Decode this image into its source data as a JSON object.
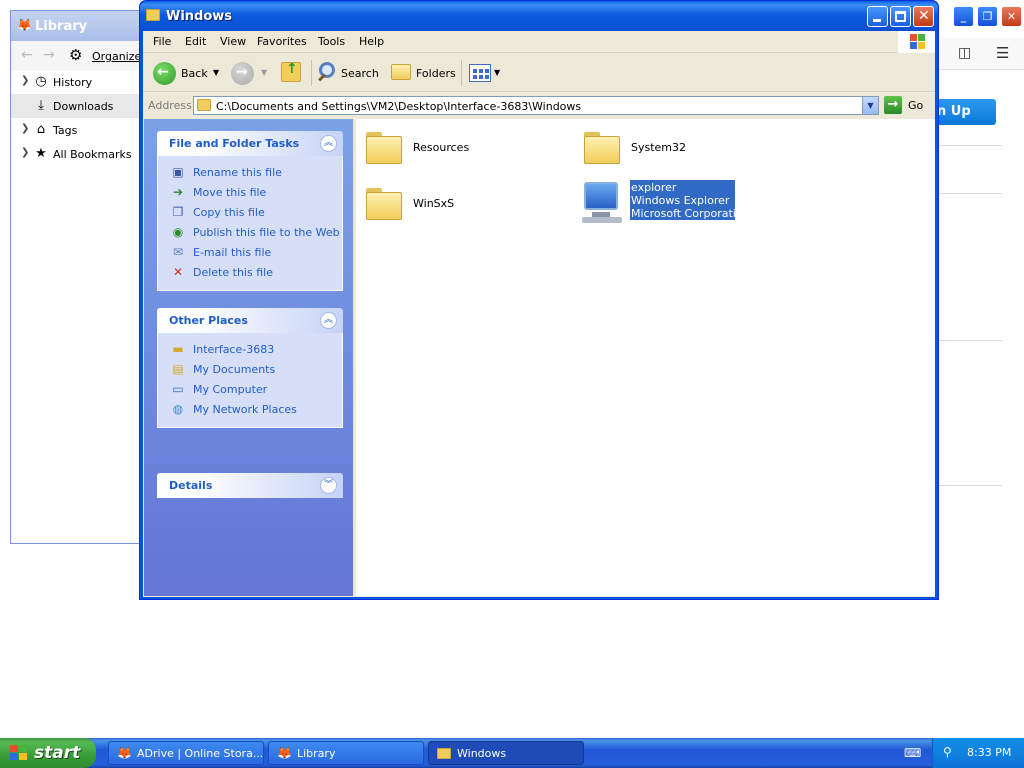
{
  "background_browser": {
    "signup_label": "n Up"
  },
  "library": {
    "title": "Library",
    "organize_label": "Organize",
    "items": [
      {
        "label": "History",
        "icon": "clock-icon",
        "expandable": true
      },
      {
        "label": "Downloads",
        "icon": "download-icon",
        "expandable": false,
        "selected": true
      },
      {
        "label": "Tags",
        "icon": "tag-icon",
        "expandable": true
      },
      {
        "label": "All Bookmarks",
        "icon": "star-icon",
        "expandable": true
      }
    ]
  },
  "explorer": {
    "title": "Windows",
    "menu": [
      "File",
      "Edit",
      "View",
      "Favorites",
      "Tools",
      "Help"
    ],
    "toolbar": {
      "back": "Back",
      "search": "Search",
      "folders": "Folders"
    },
    "address": {
      "label": "Address",
      "path": "C:\\Documents and Settings\\VM2\\Desktop\\Interface-3683\\Windows",
      "go": "Go"
    },
    "file_tasks": {
      "title": "File and Folder Tasks",
      "items": [
        {
          "label": "Rename this file",
          "icon": "rename-icon"
        },
        {
          "label": "Move this file",
          "icon": "move-icon"
        },
        {
          "label": "Copy this file",
          "icon": "copy-icon"
        },
        {
          "label": "Publish this file to the Web",
          "icon": "globe-icon"
        },
        {
          "label": "E-mail this file",
          "icon": "email-icon"
        },
        {
          "label": "Delete this file",
          "icon": "delete-icon"
        }
      ]
    },
    "other_places": {
      "title": "Other Places",
      "items": [
        {
          "label": "Interface-3683",
          "icon": "folder-icon"
        },
        {
          "label": "My Documents",
          "icon": "documents-icon"
        },
        {
          "label": "My Computer",
          "icon": "computer-icon"
        },
        {
          "label": "My Network Places",
          "icon": "network-icon"
        }
      ]
    },
    "details": {
      "title": "Details"
    },
    "files": [
      {
        "name": "Resources",
        "type": "folder"
      },
      {
        "name": "System32",
        "type": "folder"
      },
      {
        "name": "WinSxS",
        "type": "folder"
      },
      {
        "name": "explorer",
        "type": "application",
        "description": "Windows Explorer",
        "company": "Microsoft Corporation",
        "selected": true
      }
    ]
  },
  "taskbar": {
    "start": "start",
    "tasks": [
      {
        "label": "ADrive | Online Stora...",
        "icon": "firefox-icon"
      },
      {
        "label": "Library",
        "icon": "firefox-icon"
      },
      {
        "label": "Windows",
        "icon": "folder-icon",
        "active": true
      }
    ],
    "clock": "8:33 PM"
  },
  "colors": {
    "xp_blue": "#0054e3",
    "taskpane_link": "#215dc6",
    "selection": "#316ac5",
    "start_green": "#3c9a3c"
  }
}
